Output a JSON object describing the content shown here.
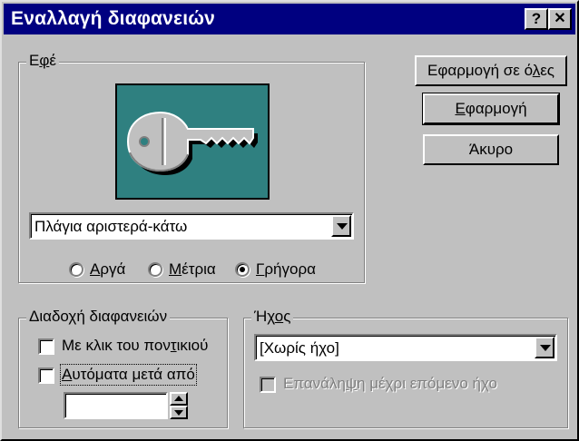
{
  "window": {
    "title": "Εναλλαγή διαφανειών",
    "help_label": "?",
    "close_label": "✕"
  },
  "effect": {
    "group_label": "Εφέ",
    "group_accel": "φ",
    "group_rest": "έ",
    "group_pre": "Ε",
    "selected_effect": "Πλάγια αριστερά-κάτω",
    "preview_icon": "key-icon",
    "speeds": [
      {
        "pre": "",
        "accel": "Α",
        "rest": "ργά",
        "checked": false
      },
      {
        "pre": "",
        "accel": "Μ",
        "rest": "έτρια",
        "checked": false
      },
      {
        "pre": "",
        "accel": "Γ",
        "rest": "ρήγορα",
        "checked": true
      }
    ]
  },
  "buttons": {
    "apply_all_pre": "Εφαρμογή σε ό",
    "apply_all_accel": "λ",
    "apply_all_rest": "ες",
    "apply_accel": "Ε",
    "apply_rest": "φαρμογή",
    "cancel_label": "Άκυρο"
  },
  "advance": {
    "group_label": "Διαδοχή διαφανειών",
    "on_click_pre": "Με κλικ του πον",
    "on_click_accel": "τ",
    "on_click_rest": "ικιού",
    "auto_pre": "",
    "auto_accel": "Α",
    "auto_rest": "υτόματα μετά από",
    "seconds_value": "",
    "on_click_checked": false,
    "auto_checked": false
  },
  "sound": {
    "group_pre": "Ήχ",
    "group_accel": "ο",
    "group_rest": "ς",
    "selected_sound": "[Χωρίς ήχο]",
    "loop_pre": "Επανάλη",
    "loop_accel": "ψ",
    "loop_rest": "η μέχρι επόμενο ήχο",
    "loop_checked": false
  },
  "colors": {
    "title_bar": "#000080",
    "face": "#c0c0c0",
    "preview_bg": "#2f8080",
    "key_fill": "#c0c0c0"
  }
}
